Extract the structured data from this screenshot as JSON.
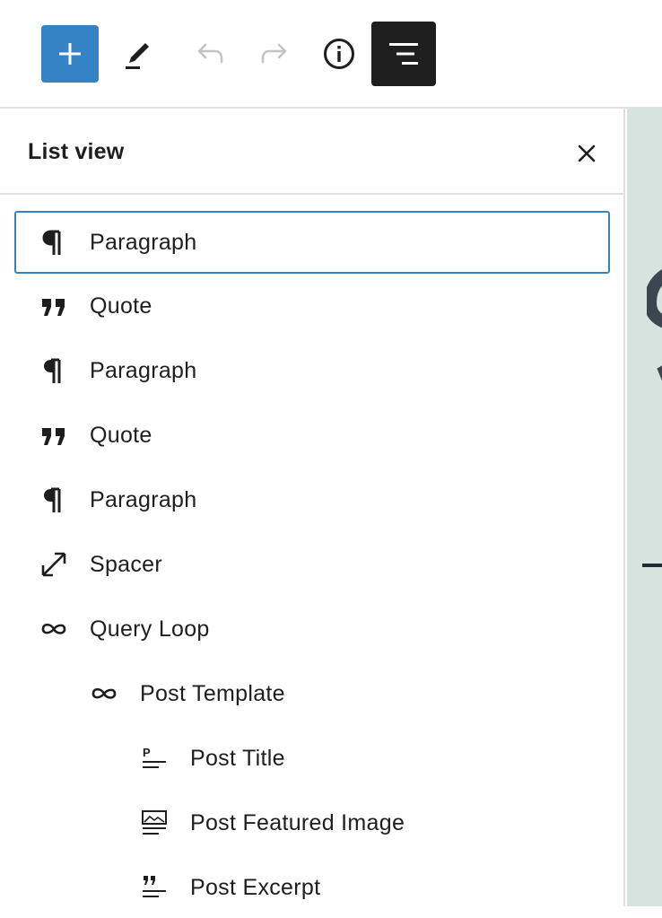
{
  "toolbar": {
    "buttons": [
      {
        "name": "add-block",
        "icon": "plus-icon"
      },
      {
        "name": "tools",
        "icon": "pencil-icon"
      },
      {
        "name": "undo",
        "icon": "undo-icon"
      },
      {
        "name": "redo",
        "icon": "redo-icon"
      },
      {
        "name": "details",
        "icon": "info-icon"
      },
      {
        "name": "list-view",
        "icon": "list-view-icon"
      }
    ],
    "accent_color": "#3582c4",
    "active_color": "#1e1e1e"
  },
  "list_view": {
    "title": "List view",
    "close_icon": "close-icon",
    "items": [
      {
        "label": "Paragraph",
        "icon": "paragraph-icon",
        "level": 0,
        "selected": true
      },
      {
        "label": "Quote",
        "icon": "quote-icon",
        "level": 0
      },
      {
        "label": "Paragraph",
        "icon": "paragraph-icon",
        "level": 0
      },
      {
        "label": "Quote",
        "icon": "quote-icon",
        "level": 0
      },
      {
        "label": "Paragraph",
        "icon": "paragraph-icon",
        "level": 0
      },
      {
        "label": "Spacer",
        "icon": "resize-arrows-icon",
        "level": 0
      },
      {
        "label": "Query Loop",
        "icon": "loop-icon",
        "level": 0
      },
      {
        "label": "Post Template",
        "icon": "loop-icon",
        "level": 1
      },
      {
        "label": "Post Title",
        "icon": "post-title-icon",
        "level": 2
      },
      {
        "label": "Post Featured Image",
        "icon": "post-featured-image-icon",
        "level": 2
      },
      {
        "label": "Post Excerpt",
        "icon": "post-excerpt-icon",
        "level": 2
      }
    ]
  },
  "editor_canvas": {
    "background_color": "#d6e3df"
  }
}
